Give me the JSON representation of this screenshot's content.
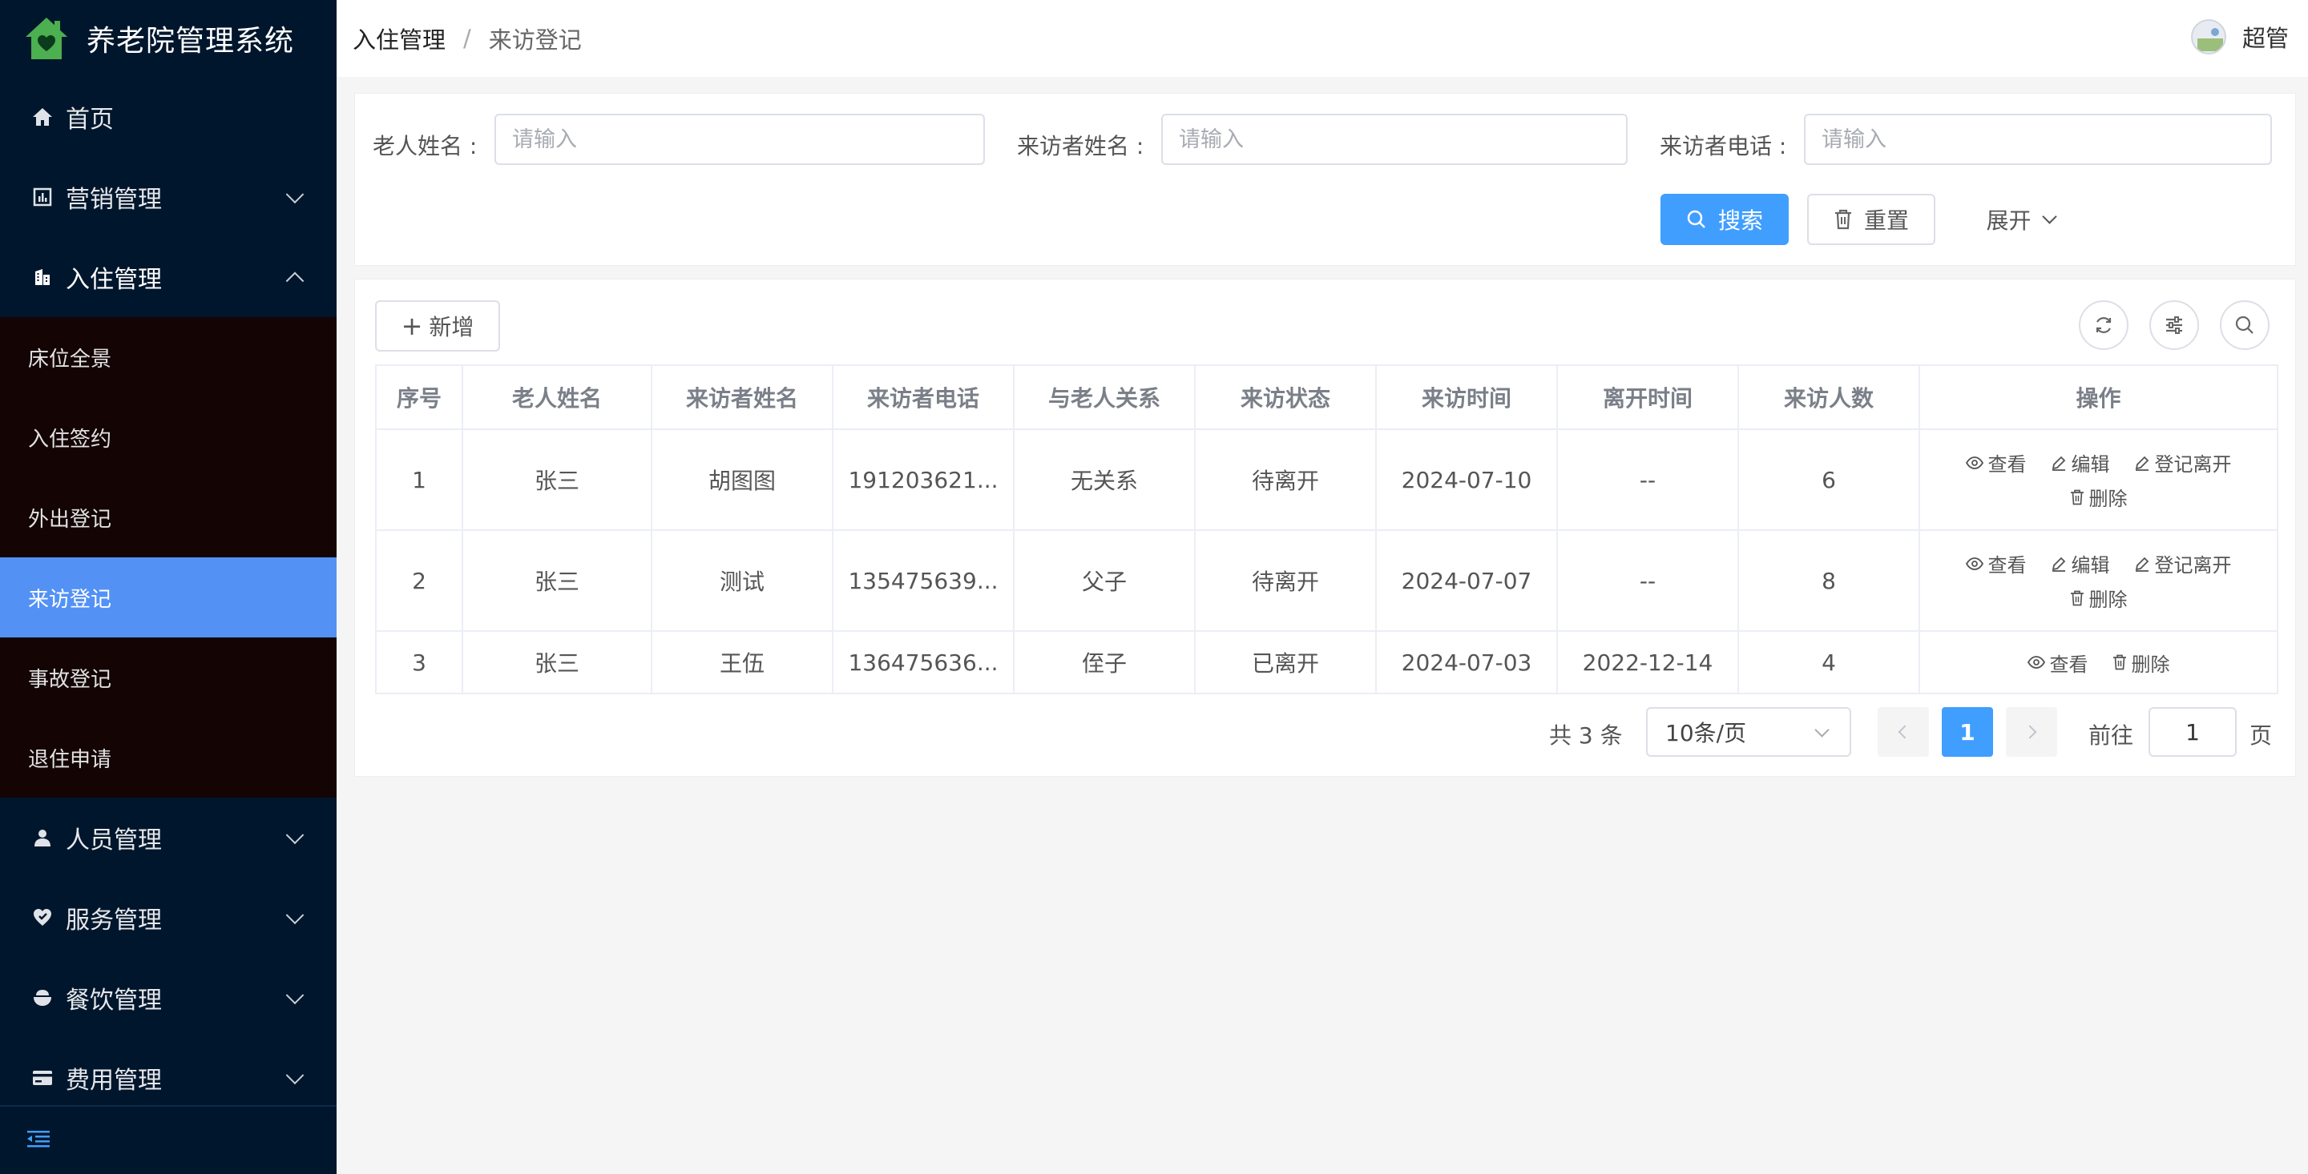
{
  "app": {
    "title": "养老院管理系统"
  },
  "colors": {
    "sidebar_bg": "#00162c",
    "submenu_bg": "#140404",
    "active": "#5391f5",
    "primary": "#409eff",
    "logo_green": "#4caf50"
  },
  "sidebar": {
    "items": [
      {
        "label": "首页",
        "icon": "home-icon"
      },
      {
        "label": "营销管理",
        "icon": "chart-icon"
      },
      {
        "label": "入住管理",
        "icon": "building-icon"
      },
      {
        "label": "人员管理",
        "icon": "user-icon"
      },
      {
        "label": "服务管理",
        "icon": "heart-hand-icon"
      },
      {
        "label": "餐饮管理",
        "icon": "bowl-icon"
      },
      {
        "label": "费用管理",
        "icon": "card-icon"
      }
    ],
    "submenu": [
      {
        "label": "床位全景"
      },
      {
        "label": "入住签约"
      },
      {
        "label": "外出登记"
      },
      {
        "label": "来访登记"
      },
      {
        "label": "事故登记"
      },
      {
        "label": "退住申请"
      }
    ]
  },
  "header": {
    "breadcrumb": [
      "入住管理",
      "来访登记"
    ],
    "separator": "/",
    "user": "超管"
  },
  "search": {
    "elder_name_label": "老人姓名 :",
    "visitor_name_label": "来访者姓名 :",
    "visitor_phone_label": "来访者电话 :",
    "placeholder": "请输入",
    "search_button": "搜索",
    "reset_button": "重置",
    "expand_button": "展开"
  },
  "toolbar": {
    "add_button": "新增"
  },
  "table": {
    "columns": [
      "序号",
      "老人姓名",
      "来访者姓名",
      "来访者电话",
      "与老人关系",
      "来访状态",
      "来访时间",
      "离开时间",
      "来访人数",
      "操作"
    ],
    "rows": [
      {
        "index": "1",
        "elder": "张三",
        "visitor": "胡图图",
        "phone": "191203621...",
        "relation": "无关系",
        "status": "待离开",
        "visit_time": "2024-07-10",
        "leave_time": "--",
        "count": "6"
      },
      {
        "index": "2",
        "elder": "张三",
        "visitor": "测试",
        "phone": "135475639...",
        "relation": "父子",
        "status": "待离开",
        "visit_time": "2024-07-07",
        "leave_time": "--",
        "count": "8"
      },
      {
        "index": "3",
        "elder": "张三",
        "visitor": "王伍",
        "phone": "136475636...",
        "relation": "侄子",
        "status": "已离开",
        "visit_time": "2024-07-03",
        "leave_time": "2022-12-14",
        "count": "4"
      }
    ],
    "actions": {
      "view": "查看",
      "edit": "编辑",
      "leave": "登记离开",
      "delete": "删除"
    }
  },
  "pagination": {
    "total": "共 3 条",
    "page_size": "10条/页",
    "current": "1",
    "goto_label": "前往",
    "goto_value": "1",
    "page_suffix": "页"
  }
}
